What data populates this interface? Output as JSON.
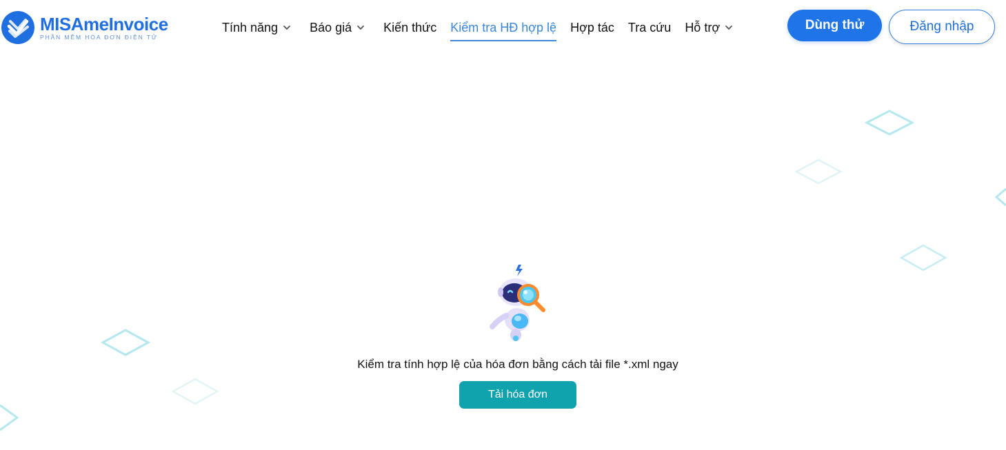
{
  "brand": {
    "name_part1": "MISA",
    "name_part2": "meInvoice",
    "tagline": "PHẦN MỀM HÓA ĐƠN ĐIỆN TỬ",
    "color": "#1f6fe0"
  },
  "nav": {
    "items": [
      {
        "label": "Tính năng",
        "has_dropdown": true,
        "active": false
      },
      {
        "label": "Báo giá",
        "has_dropdown": true,
        "active": false
      },
      {
        "label": "Kiến thức",
        "has_dropdown": false,
        "active": false
      },
      {
        "label": "Kiểm tra HĐ hợp lệ",
        "has_dropdown": false,
        "active": true
      },
      {
        "label": "Hợp tác",
        "has_dropdown": false,
        "active": false
      },
      {
        "label": "Tra cứu",
        "has_dropdown": false,
        "active": false
      },
      {
        "label": "Hỗ trợ",
        "has_dropdown": true,
        "active": false
      }
    ],
    "active_color": "#3a86d9"
  },
  "header_actions": {
    "try_label": "Dùng thử",
    "login_label": "Đăng nhập"
  },
  "main": {
    "illustration": "robot-magnifier-icon",
    "hint_text": "Kiểm tra tính hợp lệ của hóa đơn bằng cách tải file *.xml ngay",
    "upload_label": "Tải hóa đơn",
    "upload_color": "#10a3ad"
  },
  "decor": {
    "diamond_color": "#9fe0e8"
  }
}
